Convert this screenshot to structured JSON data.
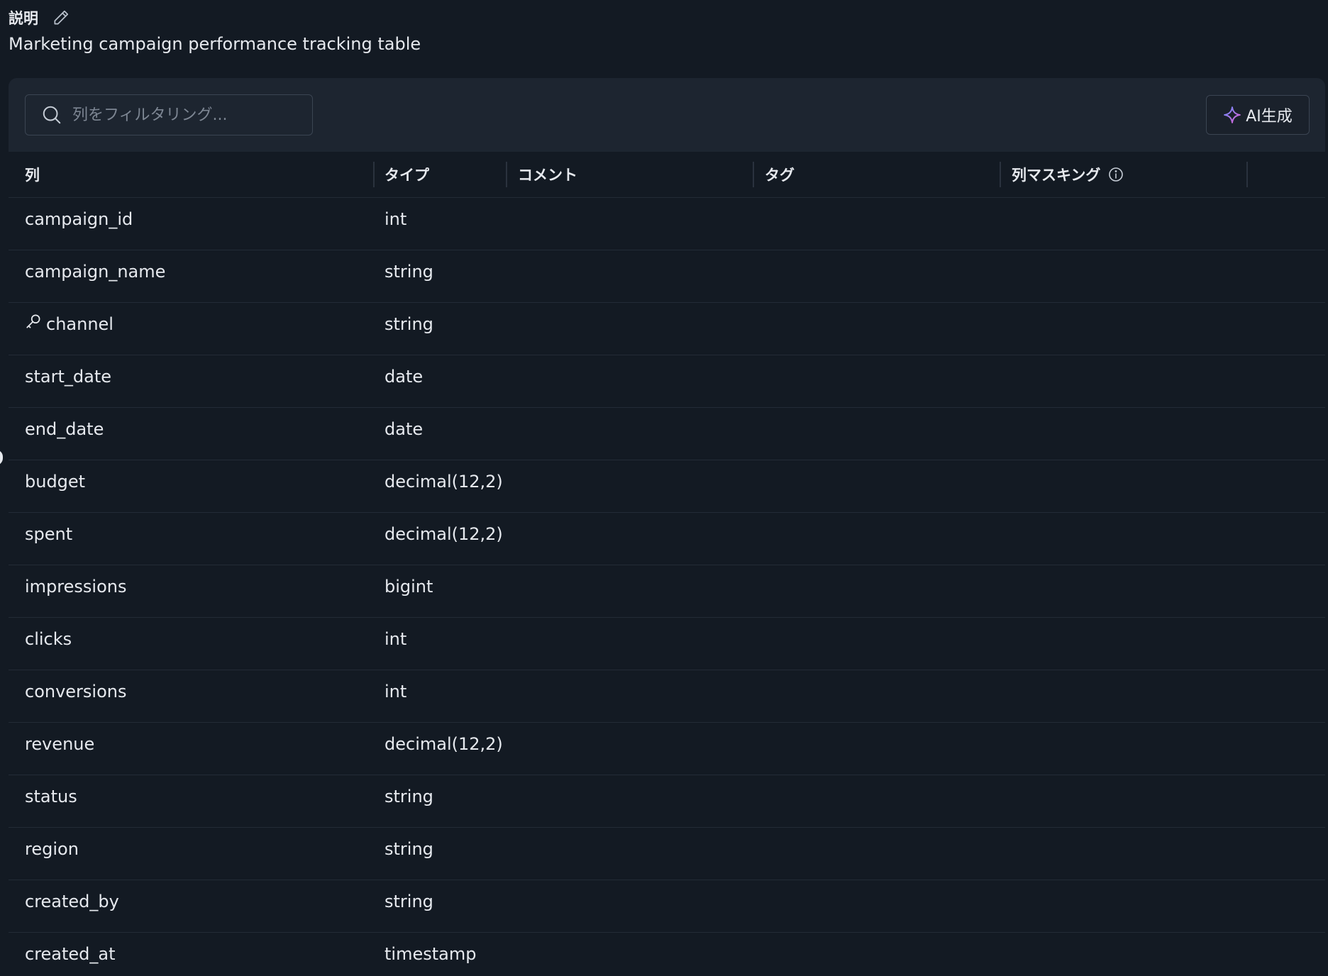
{
  "description": {
    "label": "説明",
    "text": "Marketing campaign performance tracking table"
  },
  "toolbar": {
    "search_placeholder": "列をフィルタリング...",
    "ai_button_label": "AI生成"
  },
  "table": {
    "headers": {
      "column": "列",
      "type": "タイプ",
      "comment": "コメント",
      "tags": "タグ",
      "masking": "列マスキング"
    },
    "rows": [
      {
        "name": "campaign_id",
        "type": "int"
      },
      {
        "name": "campaign_name",
        "type": "string"
      },
      {
        "name": "channel",
        "type": "string",
        "key": true
      },
      {
        "name": "start_date",
        "type": "date"
      },
      {
        "name": "end_date",
        "type": "date"
      },
      {
        "name": "budget",
        "type": "decimal(12,2)"
      },
      {
        "name": "spent",
        "type": "decimal(12,2)"
      },
      {
        "name": "impressions",
        "type": "bigint"
      },
      {
        "name": "clicks",
        "type": "int"
      },
      {
        "name": "conversions",
        "type": "int"
      },
      {
        "name": "revenue",
        "type": "decimal(12,2)"
      },
      {
        "name": "status",
        "type": "string"
      },
      {
        "name": "region",
        "type": "string"
      },
      {
        "name": "created_by",
        "type": "string"
      },
      {
        "name": "created_at",
        "type": "timestamp"
      }
    ]
  },
  "icons": {
    "edit": "pencil-icon",
    "search": "search-icon",
    "ai": "sparkle-icon",
    "info": "info-icon",
    "key": "key-icon"
  },
  "colors": {
    "background": "#131a23",
    "toolbar": "#1d2530",
    "text": "#e6e9ee",
    "muted": "#7d8693",
    "border": "#3b4552",
    "sparkle_start": "#6b8cff",
    "sparkle_end": "#e05fd0"
  }
}
